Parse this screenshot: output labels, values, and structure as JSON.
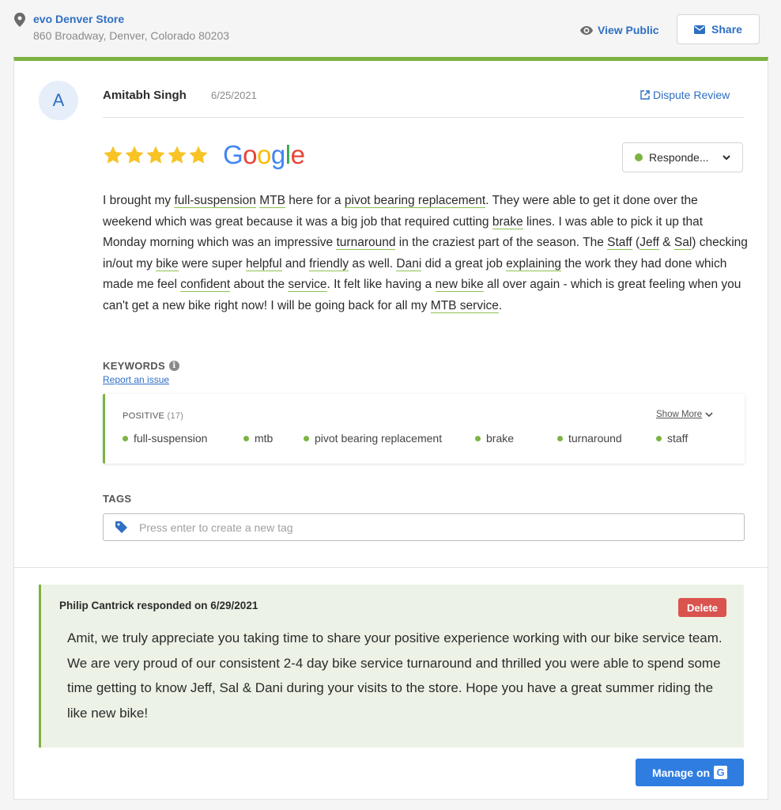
{
  "header": {
    "store_name": "evo Denver Store",
    "store_address": "860 Broadway, Denver, Colorado 80203",
    "view_public_label": "View Public",
    "share_label": "Share"
  },
  "review": {
    "avatar_initial": "A",
    "reviewer_name": "Amitabh Singh",
    "date": "6/25/2021",
    "dispute_label": "Dispute Review",
    "rating": 5,
    "source": "Google",
    "status_label": "Responde...",
    "status_color": "#7cb342",
    "body_segments": [
      {
        "t": "I brought my "
      },
      {
        "t": "full-suspension",
        "kw": true
      },
      {
        "t": " "
      },
      {
        "t": "MTB",
        "kw": true
      },
      {
        "t": " here for a "
      },
      {
        "t": "pivot bearing replacement",
        "kw": true
      },
      {
        "t": ".  They were able to get it done over the weekend which was great because it was a big job that required cutting "
      },
      {
        "t": "brake",
        "kw": true
      },
      {
        "t": " lines.  I was able to pick it up that Monday morning which was an impressive "
      },
      {
        "t": "turnaround",
        "kw": true
      },
      {
        "t": " in the craziest part of the season.  The "
      },
      {
        "t": "Staff",
        "kw": true
      },
      {
        "t": " ("
      },
      {
        "t": "Jeff",
        "kw": true
      },
      {
        "t": " & "
      },
      {
        "t": "Sal",
        "kw": true
      },
      {
        "t": ") checking in/out my "
      },
      {
        "t": "bike",
        "kw": true
      },
      {
        "t": " were super "
      },
      {
        "t": "helpful",
        "kw": true
      },
      {
        "t": " and "
      },
      {
        "t": "friendly",
        "kw": true
      },
      {
        "t": " as well.  "
      },
      {
        "t": "Dani",
        "kw": true
      },
      {
        "t": " did a great job "
      },
      {
        "t": "explaining",
        "kw": true
      },
      {
        "t": " the work they had done which made me feel "
      },
      {
        "t": "confident",
        "kw": true
      },
      {
        "t": " about the "
      },
      {
        "t": "service",
        "kw": true
      },
      {
        "t": ".  It felt like having a "
      },
      {
        "t": "new bike",
        "kw": true
      },
      {
        "t": " all over again - which is great feeling when you can't get a new bike right now!  I will be going back for all my "
      },
      {
        "t": "MTB service",
        "kw": true
      },
      {
        "t": "."
      }
    ]
  },
  "keywords": {
    "label": "KEYWORDS",
    "report_label": "Report an issue",
    "positive_label": "POSITIVE",
    "positive_count": "(17)",
    "show_more_label": "Show More",
    "items": [
      "full-suspension",
      "mtb",
      "pivot bearing replacement",
      "brake",
      "turnaround",
      "staff"
    ]
  },
  "tags": {
    "label": "TAGS",
    "placeholder": "Press enter to create a new tag",
    "value": ""
  },
  "response": {
    "header": "Philip Cantrick responded on 6/29/2021",
    "delete_label": "Delete",
    "text": "Amit, we truly appreciate you taking time to share your positive experience working with our bike service team. We are very proud of our consistent 2-4 day bike service turnaround and thrilled you were able to spend some time getting to know Jeff, Sal & Dani during your visits to the store. Hope you have a great summer riding the like new bike!"
  },
  "manage": {
    "label": "Manage on"
  },
  "colors": {
    "accent_green": "#7cb342",
    "link_blue": "#2f6fc4",
    "button_blue": "#2f7de1",
    "delete_red": "#d9534f",
    "star_yellow": "#f7c325"
  }
}
